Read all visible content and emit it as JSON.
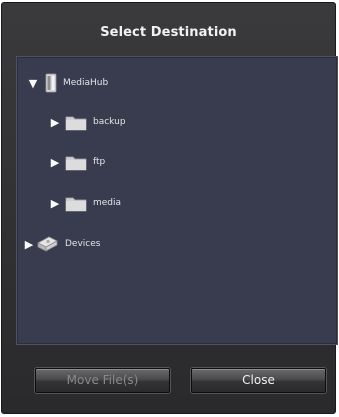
{
  "dialog": {
    "title": "Select Destination"
  },
  "tree": {
    "root": {
      "label": "MediaHub",
      "expanded": true,
      "icon": "hard-drive-icon"
    },
    "children": [
      {
        "label": "backup",
        "icon": "folder-icon"
      },
      {
        "label": "ftp",
        "icon": "folder-icon"
      },
      {
        "label": "media",
        "icon": "folder-icon"
      }
    ],
    "devices": {
      "label": "Devices",
      "expanded": false,
      "icon": "devices-icon"
    }
  },
  "buttons": {
    "move": "Move File(s)",
    "close": "Close"
  },
  "colors": {
    "dialog_bg": "#333335",
    "tree_bg": "#383c4e",
    "folder": "#cfcfcf"
  }
}
